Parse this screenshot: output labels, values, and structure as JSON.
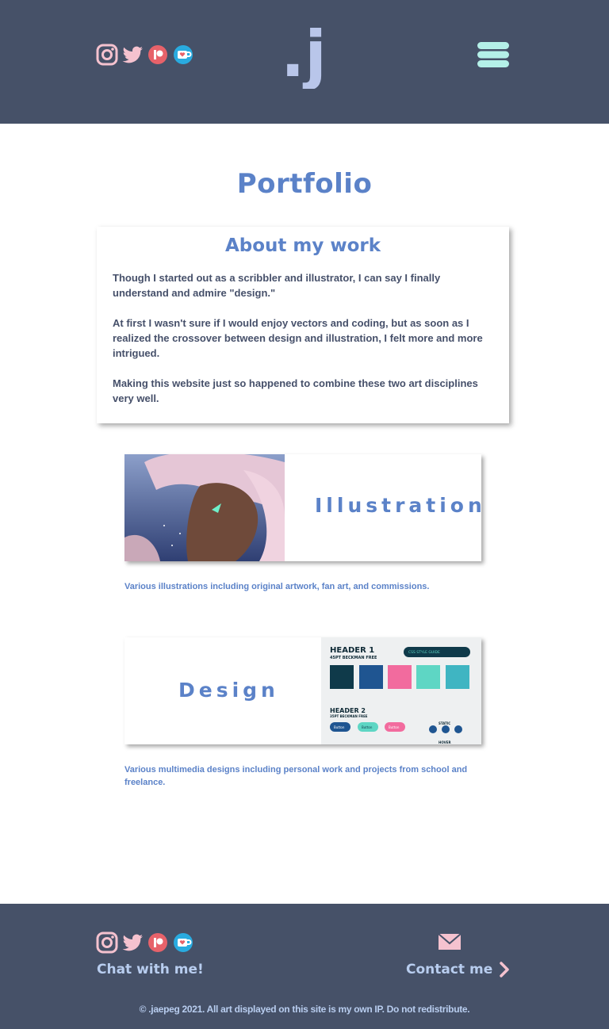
{
  "header": {
    "logo_text": ".j",
    "social_icons": [
      "instagram-icon",
      "twitter-icon",
      "patreon-icon",
      "kofi-icon"
    ],
    "menu_icon": "hamburger-menu-icon"
  },
  "main": {
    "title": "Portfolio",
    "about": {
      "heading": "About my work",
      "paragraphs": [
        "Though I started out as a scribbler and illustrator, I can say I finally understand and admire \"design.\"",
        "At first I wasn't sure if I would enjoy vectors and coding, but as soon as I realized the crossover between design and illustration, I felt more and more intrigued.",
        "Making this website just so happened to combine these two art disciplines very well."
      ]
    },
    "cards": [
      {
        "label": "Illustration",
        "description": "Various illustrations including original artwork, fan art, and commissions."
      },
      {
        "label": "Design",
        "description": "Various multimedia designs including personal work and projects from school and freelance.",
        "preview": {
          "header1": "HEADER 1",
          "header1_sub": "45PT BECKMAN FREE",
          "badge": "CSS STYLE GUIDE",
          "header2": "HEADER 2",
          "header2_sub": "35PT BECKMAN FREE",
          "button_label": "Button",
          "static_label": "STATIC",
          "hover_label": "HOVER",
          "swatches": [
            "#0f3a4a",
            "#1f5591",
            "#f26b9e",
            "#5ed6c4",
            "#3fb5c2"
          ]
        }
      }
    ]
  },
  "footer": {
    "chat_label": "Chat with me!",
    "contact_label": "Contact me",
    "copyright": "© .jaepeg 2021. All art displayed on this site is my own IP. Do not redistribute."
  },
  "colors": {
    "header_bg": "#465168",
    "accent_blue": "#5b82c8",
    "footer_text": "#b8cdef",
    "pink": "#f5c2cf",
    "menu_mint": "#b4f0e8"
  }
}
